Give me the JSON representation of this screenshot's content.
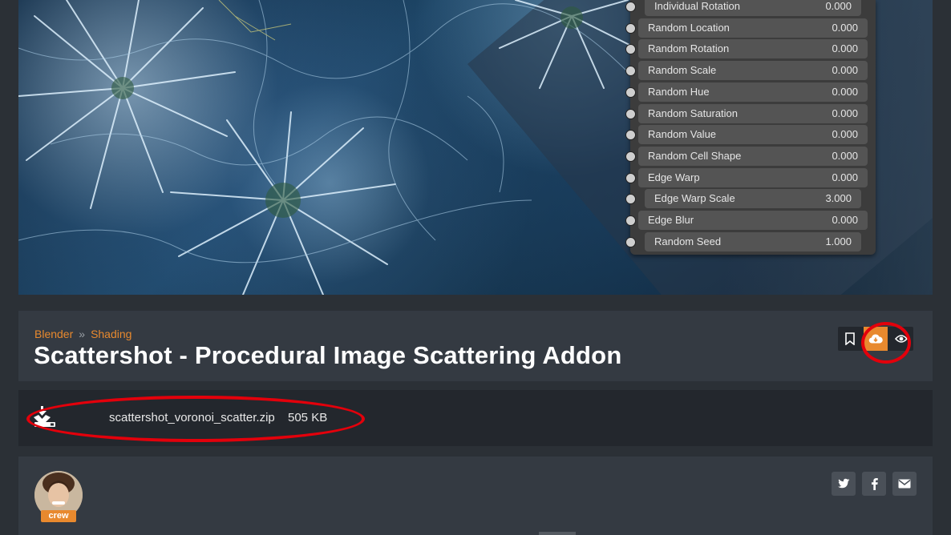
{
  "node_panel": {
    "rows": [
      {
        "label": "Individual Rotation",
        "value": "0.000"
      },
      {
        "label": "Random Location",
        "value": "0.000"
      },
      {
        "label": "Random Rotation",
        "value": "0.000"
      },
      {
        "label": "Random Scale",
        "value": "0.000"
      },
      {
        "label": "Random Hue",
        "value": "0.000"
      },
      {
        "label": "Random Saturation",
        "value": "0.000"
      },
      {
        "label": "Random Value",
        "value": "0.000"
      },
      {
        "label": "Random Cell Shape",
        "value": "0.000"
      },
      {
        "label": "Edge Warp",
        "value": "0.000"
      },
      {
        "label": "Edge Warp Scale",
        "value": "3.000"
      },
      {
        "label": "Edge Blur",
        "value": "0.000"
      },
      {
        "label": "Random Seed",
        "value": "1.000"
      }
    ]
  },
  "breadcrumb": {
    "items": [
      "Blender",
      "Shading"
    ],
    "separator": "»"
  },
  "page": {
    "title": "Scattershot - Procedural Image Scattering Addon"
  },
  "actions": {
    "icons": [
      "bookmark-icon",
      "cloud-download-icon",
      "eye-icon"
    ]
  },
  "file": {
    "icon": "download-tray-icon",
    "name": "scattershot_voronoi_scatter.zip",
    "size": "505 KB"
  },
  "author": {
    "badge": "crew"
  },
  "share": {
    "icons": [
      "twitter-icon",
      "facebook-icon",
      "email-icon"
    ]
  },
  "colors": {
    "accent": "#e8892e",
    "annotation": "#e3000b",
    "background": "#2b3036",
    "panel": "#343a42",
    "dark_panel": "#23272d"
  }
}
